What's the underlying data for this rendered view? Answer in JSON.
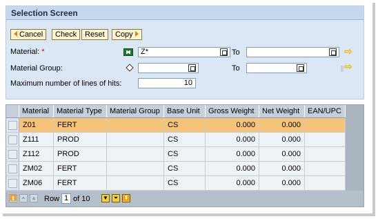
{
  "selection": {
    "title": "Selection Screen",
    "buttons": {
      "cancel": "Cancel",
      "check": "Check",
      "reset": "Reset",
      "copy": "Copy"
    },
    "fields": {
      "material": {
        "label": "Material:",
        "required_mark": "*",
        "from_value": "Z*",
        "to_label": "To",
        "to_value": ""
      },
      "material_group": {
        "label": "Material Group:",
        "from_value": "",
        "to_label": "To",
        "to_value": ""
      },
      "max_hits": {
        "label": "Maximum number of lines of hits:",
        "value": "10"
      }
    }
  },
  "table": {
    "columns": [
      "Material",
      "Material Type",
      "Material Group",
      "Base Unit",
      "Gross Weight",
      "Net Weight",
      "EAN/UPC"
    ],
    "rows": [
      {
        "material": "Z01",
        "type": "FERT",
        "group": "",
        "unit": "CS",
        "gross": "0.000",
        "net": "0.000",
        "ean": ""
      },
      {
        "material": "Z111",
        "type": "PROD",
        "group": "",
        "unit": "CS",
        "gross": "0.000",
        "net": "0.000",
        "ean": ""
      },
      {
        "material": "Z112",
        "type": "PROD",
        "group": "",
        "unit": "CS",
        "gross": "0.000",
        "net": "0.000",
        "ean": ""
      },
      {
        "material": "ZM02",
        "type": "FERT",
        "group": "",
        "unit": "CS",
        "gross": "0.000",
        "net": "0.000",
        "ean": ""
      },
      {
        "material": "ZM06",
        "type": "FERT",
        "group": "",
        "unit": "CS",
        "gross": "0.000",
        "net": "0.000",
        "ean": ""
      }
    ],
    "footer": {
      "row_label": "Row",
      "current_row": "1",
      "of_label": "of 10"
    }
  },
  "colors": {
    "panel_bg": "#dbe7f4",
    "title_bg": "#c6d8ee",
    "button_bg": "#fbf4d2",
    "highlight_row": "#f6c478",
    "table_header": "#c5d0dc"
  }
}
